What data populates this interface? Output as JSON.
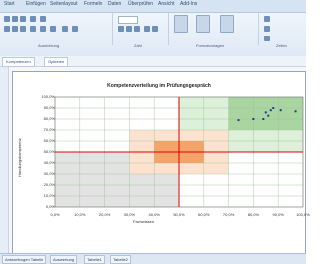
{
  "ribbon": {
    "tabs": [
      "Start",
      "Einfügen",
      "Seitenlayout",
      "Formeln",
      "Daten",
      "Überprüfen",
      "Ansicht",
      "Add-Ins"
    ],
    "groups": [
      "Ausrichtung",
      "Zahl",
      "Formatvorlagen",
      "Zellen"
    ]
  },
  "subbar": {
    "items": [
      "Kompetenzen",
      "Optionen"
    ]
  },
  "chart": {
    "title": "Kompetenzverteilung im Prüfungsgespräch",
    "ylabel": "Handlungskompetenz",
    "xlabel": "Fachwissen"
  },
  "chart_data": {
    "type": "scatter",
    "title": "Kompetenzverteilung im Prüfungsgespräch",
    "xlabel": "Fachwissen",
    "ylabel": "Handlungskompetenz",
    "xlim": [
      0,
      100
    ],
    "ylim": [
      0,
      100
    ],
    "x_ticks": [
      "0,0%",
      "10,0%",
      "20,0%",
      "30,0%",
      "40,0%",
      "50,0%",
      "60,0%",
      "70,0%",
      "80,0%",
      "90,0%",
      "100,0%"
    ],
    "y_ticks": [
      "100,0%",
      "90,0%",
      "80,0%",
      "70,0%",
      "60,0%",
      "50,0%",
      "40,0%",
      "30,0%",
      "20,0%",
      "10,0%",
      "0,0%"
    ],
    "reference_lines": {
      "x": 50,
      "y": 50
    },
    "colors": {
      "green_light": "#ddf0d9",
      "green_dark": "#a9d6a0",
      "orange_light": "#fde3cf",
      "orange_dark": "#f6a36a",
      "grey": "#e3e3e3",
      "red": "#e00000",
      "point": "#1f3a93"
    },
    "series": [
      {
        "points": [
          [
            74,
            79
          ],
          [
            80,
            80
          ],
          [
            84,
            80
          ],
          [
            86,
            83
          ],
          [
            87,
            88
          ],
          [
            88,
            90
          ],
          [
            85,
            86
          ],
          [
            91,
            88
          ],
          [
            97,
            87
          ]
        ]
      }
    ]
  },
  "bottom": {
    "tabs": [
      "Antwortbogen Tabelle",
      "Auswertung",
      "Tabelle1",
      "Tabelle2"
    ]
  }
}
